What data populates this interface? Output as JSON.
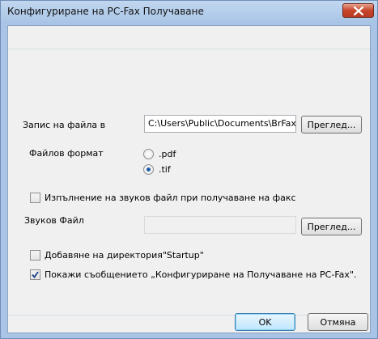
{
  "window": {
    "title": "Конфигуриране на PC-Fax Получаване"
  },
  "save_to": {
    "label": "Запис на файла в",
    "path_value": "C:\\Users\\Public\\Documents\\BrFaxF",
    "browse_label": "Преглед..."
  },
  "file_format": {
    "label": "Файлов формат",
    "options": [
      {
        "label": ".pdf",
        "selected": false
      },
      {
        "label": ".tif",
        "selected": true
      }
    ]
  },
  "play_sound": {
    "label": "Изпълнение на звуков файл при получаване на факс",
    "checked": false
  },
  "sound_file": {
    "label": "Звуков Файл",
    "value": "",
    "browse_label": "Преглед..."
  },
  "startup": {
    "label": "Добавяне на директория\"Startup\"",
    "checked": false
  },
  "show_message": {
    "label": "Покажи съобщението „Конфигуриране на Получаване на PC-Fax\".",
    "checked": true
  },
  "footer": {
    "ok_label": "OK",
    "cancel_label": "Отмяна"
  },
  "colors": {
    "title_bar": "#a8c4e6",
    "close_button": "#c7452b",
    "dialog_bg": "#f0f0f0",
    "radio_dot": "#1c5ba8",
    "check_mark": "#1c3f8a"
  }
}
